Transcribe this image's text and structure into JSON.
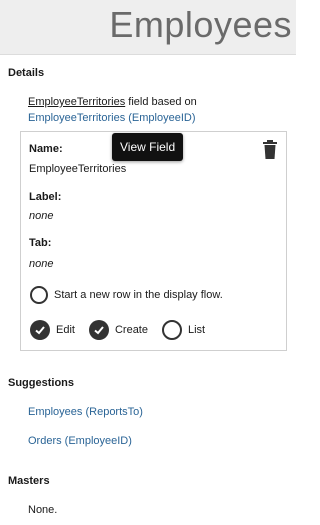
{
  "header": {
    "title": "Employees"
  },
  "details": {
    "section_title": "Details",
    "field_link_text": "EmployeeTerritories",
    "field_based_on_text": " field based on",
    "based_on_link": "EmployeeTerritories (EmployeeID)",
    "card": {
      "name_label": "Name:",
      "name_value": "EmployeeTerritories",
      "label_label": "Label:",
      "label_value": "none",
      "tab_label": "Tab:",
      "tab_value": "none",
      "new_row_text": "Start a new row in the display flow.",
      "options": {
        "edit": "Edit",
        "create": "Create",
        "list": "List"
      }
    },
    "tooltip": "View Field",
    "trash_icon": "trash-icon"
  },
  "suggestions": {
    "section_title": "Suggestions",
    "items": [
      "Employees (ReportsTo)",
      "Orders (EmployeeID)"
    ]
  },
  "masters": {
    "section_title": "Masters",
    "value": "None."
  }
}
